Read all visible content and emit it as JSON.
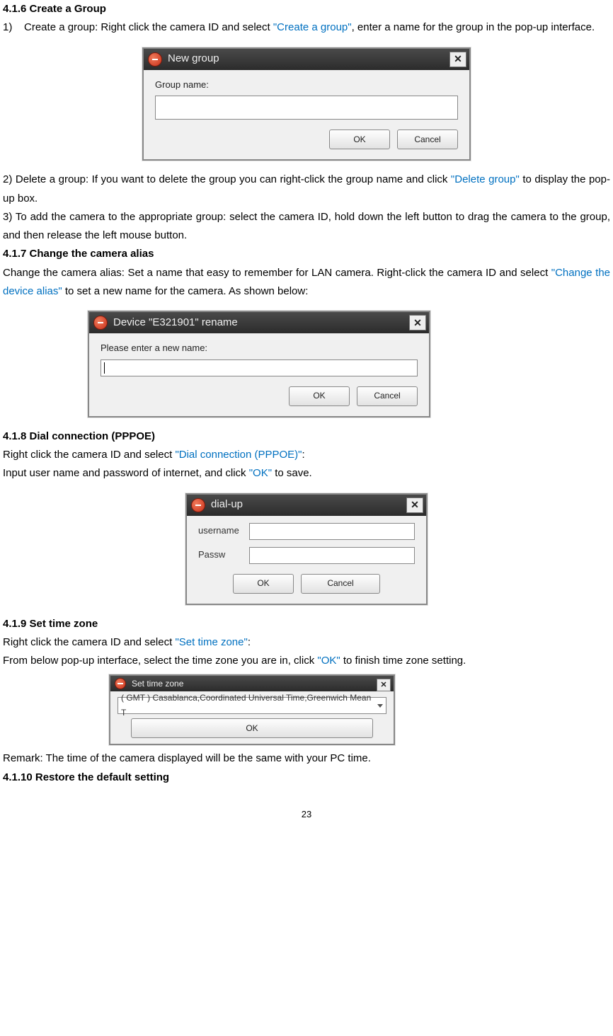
{
  "sections": {
    "s416_title": "4.1.6 Create a Group",
    "s416_step1_prefix": "1)",
    "s416_step1_text_a": "Create a group: Right click the camera ID and select ",
    "s416_step1_link": "\"Create a group\"",
    "s416_step1_text_b": ", enter a name for the group in the pop-up interface.",
    "s416_step2_a": "2) Delete a group: If you want to delete the group you can right-click the group name and click ",
    "s416_step2_link": "\"Delete group\"",
    "s416_step2_b": " to display the pop-up box.",
    "s416_step3": "3) To add the camera to the appropriate group: select the camera ID, hold down the left button to drag the camera to the group, and then release the left mouse button.",
    "s417_title": "4.1.7 Change the camera alias",
    "s417_text_a": "Change the camera alias: Set a name that easy to remember for LAN camera. Right-click the camera ID and select ",
    "s417_link": "\"Change the device alias\"",
    "s417_text_b": " to set a new name for the camera. As shown below:",
    "s418_title": "4.1.8 Dial connection (PPPOE)",
    "s418_line1_a": "Right click the camera ID and select ",
    "s418_line1_link": "\"Dial connection (PPPOE)\"",
    "s418_line1_b": ":",
    "s418_line2_a": "Input user name and password of internet, and click ",
    "s418_line2_link": "\"OK\"",
    "s418_line2_b": " to save.",
    "s419_title": "4.1.9 Set time zone",
    "s419_line1_a": "Right click the camera ID and select ",
    "s419_line1_link": "\"Set time zone\"",
    "s419_line1_b": ":",
    "s419_line2_a": "From below pop-up interface, select the time zone you are in, click ",
    "s419_line2_link": "\"OK\"",
    "s419_line2_b": " to finish time zone setting.",
    "s419_remark": "Remark: The time of the camera displayed will be the same with your PC time.",
    "s4110_title": "4.1.10 Restore the default setting"
  },
  "dialog1": {
    "title": "New group",
    "label": "Group name:",
    "ok": "OK",
    "cancel": "Cancel"
  },
  "dialog2": {
    "title": "Device \"E321901\" rename",
    "label": "Please enter a new name:",
    "ok": "OK",
    "cancel": "Cancel"
  },
  "dialog3": {
    "title": "dial-up",
    "username_label": "username",
    "password_label": "Passw",
    "ok": "OK",
    "cancel": "Cancel"
  },
  "dialog4": {
    "title": "Set time zone",
    "selected": "( GMT ) Casablanca,Coordinated Universal Time,Greenwich Mean T",
    "ok": "OK"
  },
  "page_number": "23"
}
